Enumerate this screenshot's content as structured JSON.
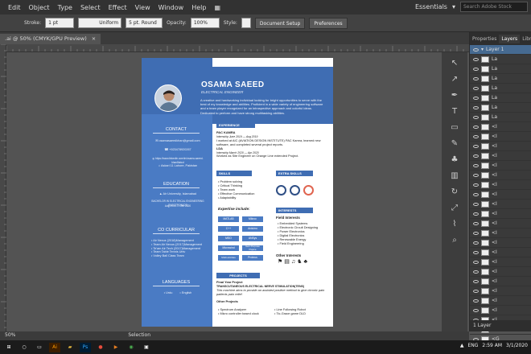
{
  "menu": {
    "items": [
      "Edit",
      "Object",
      "Type",
      "Select",
      "Effect",
      "View",
      "Window",
      "Help"
    ],
    "workspace": "Essentials",
    "search_placeholder": "Search Adobe Stock"
  },
  "control": {
    "stroke_label": "Stroke:",
    "stroke_value": "1 pt",
    "profile": "Uniform",
    "brush": "5 pt. Round",
    "opacity_label": "Opacity:",
    "opacity_value": "100%",
    "style_label": "Style:",
    "doc_setup": "Document Setup",
    "preferences": "Preferences"
  },
  "tab": {
    "label": ".ai @ 50% (CMYK/GPU Preview)",
    "close": "×"
  },
  "panel": {
    "tabs": [
      "Properties",
      "Layers",
      "Librarie"
    ],
    "layer_top": "Layer 1",
    "rows": [
      "La",
      "La",
      "La",
      "La",
      "La",
      "La",
      "La",
      "<I",
      "<I",
      "<I",
      "<I",
      "<I",
      "<I",
      "<I",
      "<I",
      "<I",
      "<I",
      "<I",
      "<I",
      "<I",
      "<I",
      "<I",
      "<I",
      "<I",
      "<I",
      "<I",
      "<I",
      "<I",
      "<I",
      "<G"
    ],
    "footer": "1 Layer"
  },
  "status": {
    "zoom": "50%",
    "mode": "Selection"
  },
  "taskbar": {
    "lang": "ENG",
    "time": "2:59 AM",
    "date": "3/1/2020"
  },
  "resume": {
    "name": "OSAMA SAEED",
    "role": "ELECTRICAL ENGINEER",
    "intro": "A creative and hardworking individual looking for bright opportunities to serve with the best of my knowledge and abilities. Proficient in a wide variety of engineering software and a team player recognized for an introspective approach and colorful ideas. Dedicated to perform and have strong multitasking abilities.",
    "contact": {
      "heading": "CONTACT",
      "email": "osamasaeedkhan@gmail.com",
      "phone": "+923478920267",
      "web": "https://www.linkedin.com/in/osama-saeed-khan8abcd",
      "address": "Askari 11 Lahore, Pakistan"
    },
    "education": {
      "heading": "EDUCATION",
      "school": "Air University, Islamabad",
      "degree": "BACHELOR IN ELECTRICAL ENGINEERING (ELECTRONICS)",
      "dates": "Aug 2016 — Dec 2020"
    },
    "cocurricular": {
      "heading": "CO CURRICULAR",
      "items": [
        "Air Nexus (2018)Management",
        "Team Air Nexus (2017)Management",
        "Te'am Air Tech (2017)Management",
        "Team Table Tennis Univ",
        "Volley Ball Class Team"
      ]
    },
    "languages": {
      "heading": "LANGUAGES",
      "items": [
        "Urdu",
        "English"
      ]
    },
    "experience": {
      "heading": "EXPERIENCE",
      "org1": "PAC KAMRA",
      "dates1": "Internship June 2019 — Aug 2019",
      "desc1": "I worked at AIC (AVIATION DESIGN INSTITUTE) PAC Kamra, learned new software, and completed several project reports.",
      "org2": "LDA",
      "dates2": "Internship March 2020 — Apr 2020",
      "desc2": "Worked as Site Engineer on Orange Line extended Project."
    },
    "skills": {
      "heading": "SKILLS",
      "items": [
        "Problem solving",
        "Critical Thinking",
        "Team work",
        "Effective Communication",
        "Adaptability"
      ]
    },
    "extra_skills": {
      "heading": "EXTRA SKILLS"
    },
    "expertise": {
      "heading": "Expertise include:",
      "items": [
        "MATLAB",
        "Mikroc",
        "C++",
        "Arduino",
        "MSO",
        "ANSys",
        "Microwind",
        "Gen Purpose Pspice",
        "Multi-sim/ites",
        "Proteus"
      ]
    },
    "interests": {
      "heading": "INTERESTS",
      "field_heading": "Field Interests",
      "field_items": [
        "Embedded Systems",
        "Electronic Circuit Designing",
        "Power Electronics",
        "Digital Electronics",
        "Renewable Energy",
        "Field Engineering"
      ],
      "other_heading": "Other Interests"
    },
    "projects": {
      "heading": "PROJECTS",
      "fyp_heading": "Final Year Project",
      "fyp_title": "TRANSCUTANEOUS ELECTRICAL NERVE STIMULATION(TENS)",
      "fyp_desc": "This machine aims to provide an assisted positive method to give chronic pain patients pain relief.",
      "other_heading": "Other Projects",
      "other_items": [
        "Spectrum Analyzer",
        "Micro controller based clock",
        "Line Following Robot",
        "Tic-Grace game DLD"
      ]
    }
  },
  "colors": {
    "accent": "#3f6db3",
    "sidebar": "#4a7bc4",
    "app_bg": "#535353"
  }
}
